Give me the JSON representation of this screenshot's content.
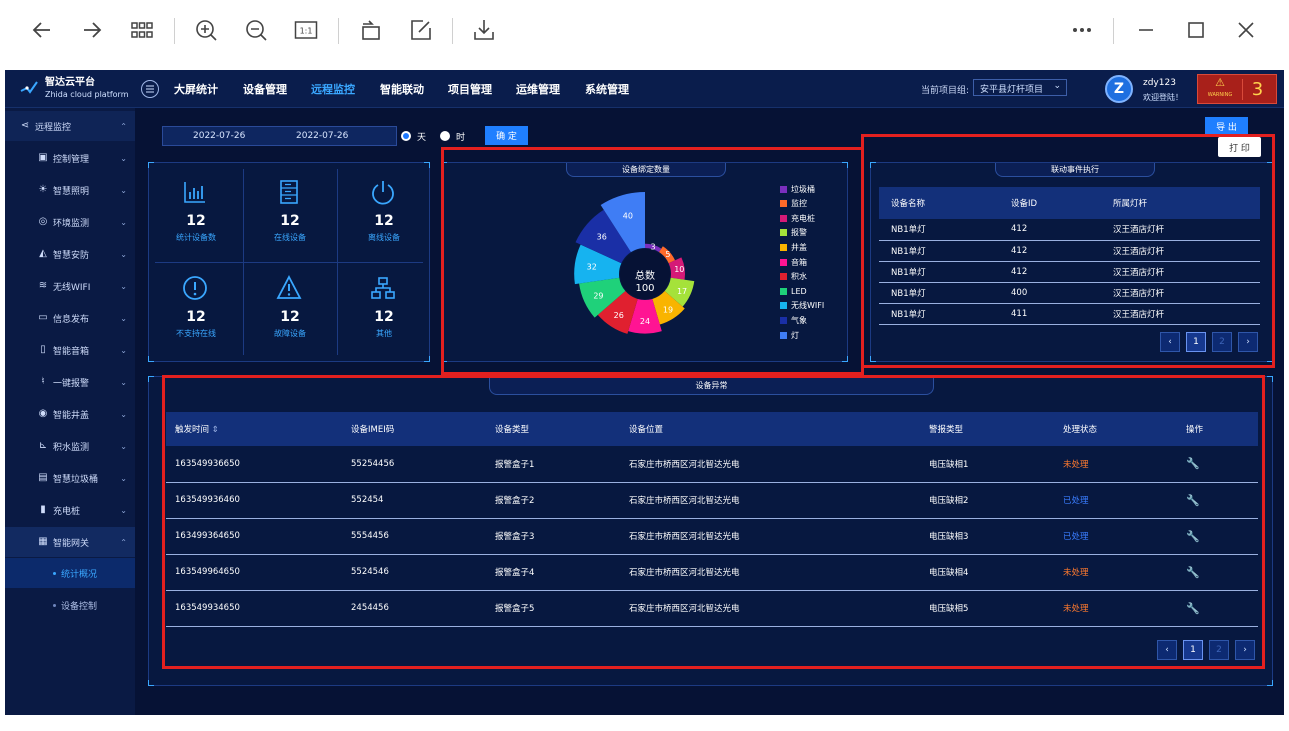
{
  "toolbar": {
    "icons": [
      "back-arrow-icon",
      "forward-arrow-icon",
      "grid-view-icon",
      "zoom-in-icon",
      "zoom-out-icon",
      "actual-size-icon",
      "rotate-icon",
      "edit-icon",
      "download-icon",
      "more-icon",
      "minimize-icon",
      "maximize-icon",
      "close-icon"
    ],
    "actual_size_label": "1:1"
  },
  "app": {
    "logo_title": "智达云平台",
    "logo_subtitle": "Zhida cloud platform",
    "nav": [
      "大屏统计",
      "设备管理",
      "远程监控",
      "智能联动",
      "项目管理",
      "运维管理",
      "系统管理"
    ],
    "nav_active": "远程监控",
    "project_label": "当前项目组:",
    "project_value": "安平县灯杆项目",
    "user_name": "zdy123",
    "user_greeting": "欢迎登陆！",
    "warning_text": "WARNING",
    "warning_count": "3"
  },
  "sidebar": {
    "header": "远程监控",
    "items": [
      "控制管理",
      "智慧照明",
      "环境监测",
      "智慧安防",
      "无线WIFI",
      "信息发布",
      "智能音箱",
      "一键报警",
      "智能井盖",
      "积水监测",
      "智慧垃圾桶",
      "充电桩",
      "智能网关"
    ],
    "subitems": [
      "统计概况",
      "设备控制"
    ],
    "active_sub": "统计概况"
  },
  "filter": {
    "start_date": "2022-07-26",
    "end_date": "2022-07-26",
    "radio_day": "天",
    "radio_hour": "时",
    "confirm": "确 定",
    "export": "导 出",
    "print": "打 印"
  },
  "stats": [
    {
      "icon": "bar-chart-icon",
      "value": "12",
      "label": "统计设备数"
    },
    {
      "icon": "server-icon",
      "value": "12",
      "label": "在线设备"
    },
    {
      "icon": "power-icon",
      "value": "12",
      "label": "离线设备"
    },
    {
      "icon": "alert-circle-icon",
      "value": "12",
      "label": "不支持在线"
    },
    {
      "icon": "warning-triangle-icon",
      "value": "12",
      "label": "故障设备"
    },
    {
      "icon": "network-icon",
      "value": "12",
      "label": "其他"
    }
  ],
  "chart_data": {
    "type": "pie",
    "title": "设备绑定数量",
    "center_label": "总数",
    "center_value": "100",
    "categories": [
      "垃圾桶",
      "监控",
      "充电桩",
      "报警",
      "井盖",
      "音箱",
      "积水",
      "LED",
      "无线WIFI",
      "气象",
      "灯"
    ],
    "values": [
      3,
      5,
      10,
      17,
      19,
      24,
      26,
      29,
      32,
      36,
      40
    ],
    "colors": [
      "#7b2fbe",
      "#ff6a2a",
      "#d51a77",
      "#a5e23a",
      "#f9b400",
      "#ff1493",
      "#e0202f",
      "#1fd17a",
      "#16b3f0",
      "#1a2fa6",
      "#3f7df5"
    ]
  },
  "linkage": {
    "title": "联动事件执行",
    "columns": [
      "设备名称",
      "设备ID",
      "所属灯杆"
    ],
    "rows": [
      [
        "NB1单灯",
        "412",
        "汉王酒店灯杆"
      ],
      [
        "NB1单灯",
        "412",
        "汉王酒店灯杆"
      ],
      [
        "NB1单灯",
        "412",
        "汉王酒店灯杆"
      ],
      [
        "NB1单灯",
        "400",
        "汉王酒店灯杆"
      ],
      [
        "NB1单灯",
        "411",
        "汉王酒店灯杆"
      ]
    ],
    "pages": [
      "1",
      "2"
    ]
  },
  "anomaly": {
    "title": "设备异常",
    "columns": [
      "触发时间",
      "设备IMEI码",
      "设备类型",
      "设备位置",
      "警报类型",
      "处理状态",
      "操作"
    ],
    "rows": [
      [
        "163549936650",
        "55254456",
        "报警盒子1",
        "石家庄市桥西区河北智达光电",
        "电压缺相1",
        "未处理"
      ],
      [
        "163549936460",
        "552454",
        "报警盒子2",
        "石家庄市桥西区河北智达光电",
        "电压缺相2",
        "已处理"
      ],
      [
        "163499364650",
        "5554456",
        "报警盒子3",
        "石家庄市桥西区河北智达光电",
        "电压缺相3",
        "已处理"
      ],
      [
        "163549964650",
        "5524546",
        "报警盒子4",
        "石家庄市桥西区河北智达光电",
        "电压缺相4",
        "未处理"
      ],
      [
        "163549934650",
        "2454456",
        "报警盒子5",
        "石家庄市桥西区河北智达光电",
        "电压缺相5",
        "未处理"
      ]
    ],
    "pages": [
      "1",
      "2"
    ]
  }
}
